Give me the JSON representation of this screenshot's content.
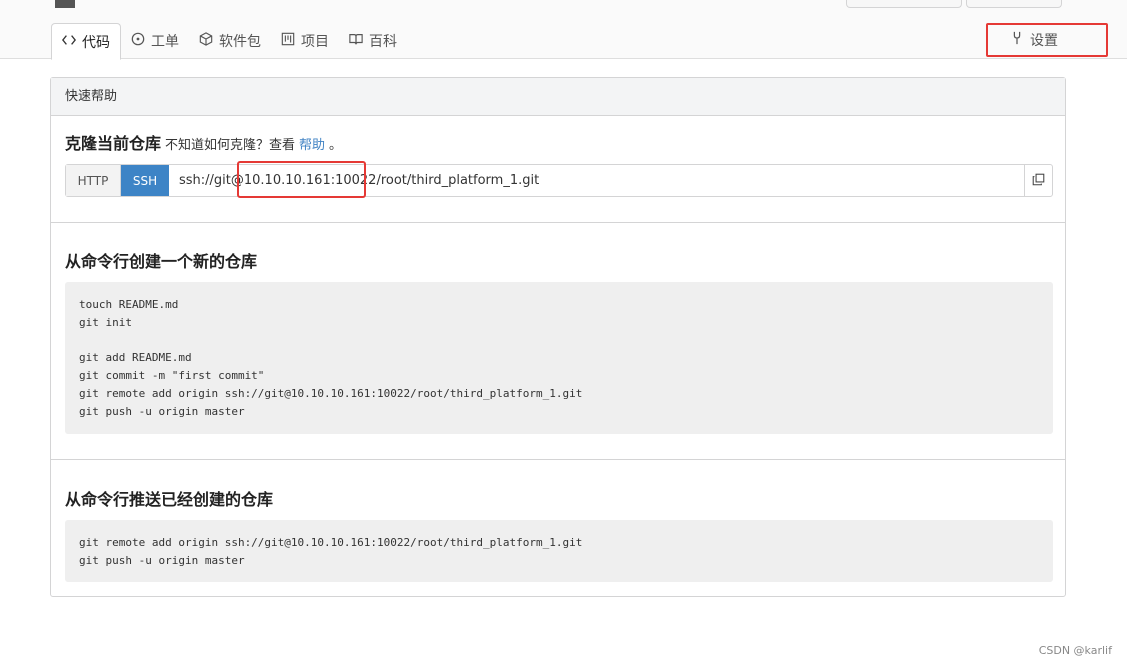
{
  "tabs": [
    {
      "label": "代码",
      "icon": "code-icon",
      "active": true
    },
    {
      "label": "工单",
      "icon": "issue-icon",
      "active": false
    },
    {
      "label": "软件包",
      "icon": "package-icon",
      "active": false
    },
    {
      "label": "项目",
      "icon": "project-icon",
      "active": false
    },
    {
      "label": "百科",
      "icon": "wiki-icon",
      "active": false
    }
  ],
  "settings": {
    "label": "设置",
    "icon": "settings-icon"
  },
  "panel": {
    "header": "快速帮助"
  },
  "clone": {
    "title": "克隆当前仓库",
    "hint_prefix": "不知道如何克隆？查看",
    "help_link": "帮助",
    "hint_suffix": "。",
    "http_label": "HTTP",
    "ssh_label": "SSH",
    "url": "ssh://git@10.10.10.161:10022/root/third_platform_1.git"
  },
  "new_repo": {
    "title": "从命令行创建一个新的仓库",
    "code": "touch README.md\ngit init\n\ngit add README.md\ngit commit -m \"first commit\"\ngit remote add origin ssh://git@10.10.10.161:10022/root/third_platform_1.git\ngit push -u origin master"
  },
  "push_existing": {
    "title": "从命令行推送已经创建的仓库",
    "code": "git remote add origin ssh://git@10.10.10.161:10022/root/third_platform_1.git\ngit push -u origin master"
  },
  "watermark": "CSDN @karlif",
  "colors": {
    "accent": "#3d84c6",
    "link": "#4183c4",
    "highlight": "#e53935"
  }
}
